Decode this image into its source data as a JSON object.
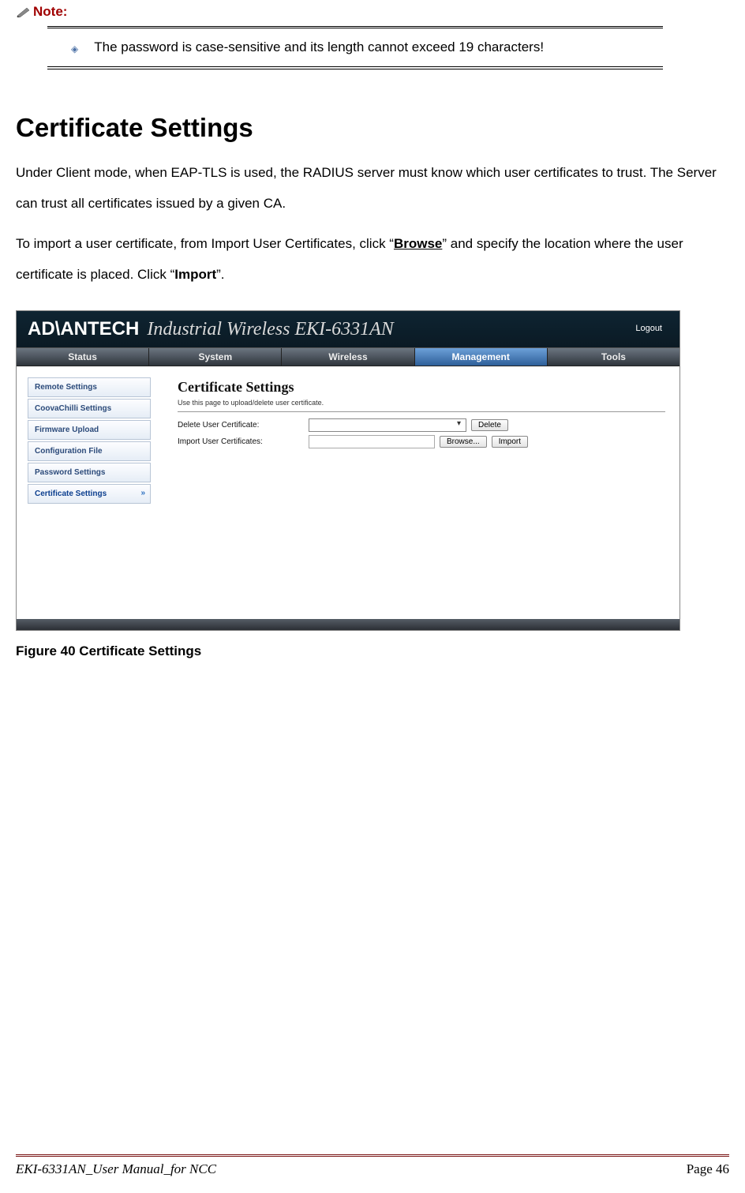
{
  "note": {
    "label": "Note:",
    "text": "The password is case-sensitive and its length cannot exceed 19 characters!"
  },
  "section": {
    "heading": "Certificate Settings",
    "para1_a": "Under Client mode, when EAP-TLS is used, the RADIUS server must know which user certificates to trust.    The Server can trust all certificates issued by a given CA.",
    "para2_a": "To import a user certificate, from Import User Certificates, click “",
    "para2_bold1": "Browse",
    "para2_b": "” and specify the location where the user certificate is placed.    Click “",
    "para2_bold2": "Import",
    "para2_c": "”."
  },
  "screenshot": {
    "logo": "AD\\ANTECH",
    "product": "Industrial Wireless EKI-6331AN",
    "logout": "Logout",
    "nav": [
      "Status",
      "System",
      "Wireless",
      "Management",
      "Tools"
    ],
    "nav_active_index": 3,
    "sidebar": [
      "Remote Settings",
      "CoovaChilli Settings",
      "Firmware Upload",
      "Configuration File",
      "Password Settings",
      "Certificate Settings"
    ],
    "sidebar_active_index": 5,
    "content_title": "Certificate Settings",
    "content_sub": "Use this page to upload/delete user certificate.",
    "row1_label": "Delete User Certificate:",
    "row1_btn": "Delete",
    "row2_label": "Import User Certificates:",
    "row2_browse": "Browse...",
    "row2_btn": "Import"
  },
  "figure_caption": "Figure 40 Certificate Settings",
  "footer": {
    "left": "EKI-6331AN_User Manual_for NCC",
    "right": "Page 46"
  }
}
